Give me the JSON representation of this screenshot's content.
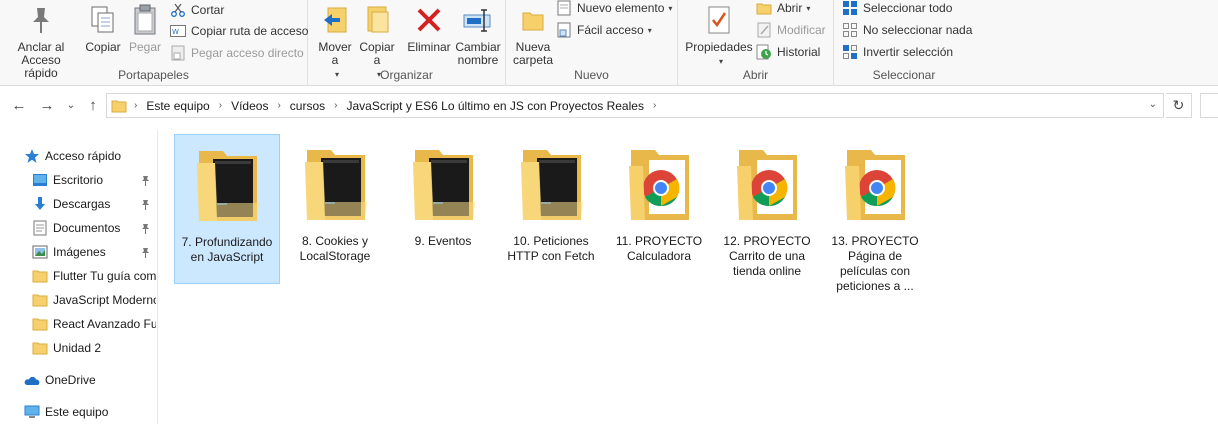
{
  "ribbon": {
    "portapapeles": {
      "label": "Portapapeles",
      "anclar": "Anclar al Acceso rápido",
      "copiar": "Copiar",
      "pegar": "Pegar",
      "cortar": "Cortar",
      "copiar_ruta": "Copiar ruta de acceso",
      "pegar_acceso": "Pegar acceso directo"
    },
    "organizar": {
      "label": "Organizar",
      "mover": "Mover a",
      "copiar_a": "Copiar a",
      "eliminar": "Eliminar",
      "cambiar": "Cambiar nombre"
    },
    "nuevo": {
      "label": "Nuevo",
      "nueva_carpeta": "Nueva carpeta",
      "nuevo_elemento": "Nuevo elemento",
      "facil_acceso": "Fácil acceso"
    },
    "abrir": {
      "label": "Abrir",
      "propiedades": "Propiedades",
      "abrir": "Abrir",
      "modificar": "Modificar",
      "historial": "Historial"
    },
    "seleccionar": {
      "label": "Seleccionar",
      "todo": "Seleccionar todo",
      "nada": "No seleccionar nada",
      "invertir": "Invertir selección"
    }
  },
  "breadcrumb": [
    "Este equipo",
    "Vídeos",
    "cursos",
    "JavaScript y ES6 Lo último en JS con Proyectos Reales"
  ],
  "navpane": {
    "quick_access": "Acceso rápido",
    "pinned": [
      "Escritorio",
      "Descargas",
      "Documentos",
      "Imágenes"
    ],
    "folders": [
      "Flutter Tu guía com",
      "JavaScript Moderno",
      "React Avanzado Ful",
      "Unidad 2"
    ],
    "onedrive": "OneDrive",
    "this_pc": "Este equipo"
  },
  "items": [
    {
      "name": "7. Profundizando en JavaScript",
      "thumb": "video",
      "selected": true
    },
    {
      "name": "8. Cookies y LocalStorage",
      "thumb": "video",
      "selected": false
    },
    {
      "name": "9. Eventos",
      "thumb": "video",
      "selected": false
    },
    {
      "name": "10. Peticiones HTTP con Fetch",
      "thumb": "video",
      "selected": false
    },
    {
      "name": "11. PROYECTO Calculadora",
      "thumb": "chrome",
      "selected": false
    },
    {
      "name": "12. PROYECTO Carrito de una tienda online",
      "thumb": "chrome",
      "selected": false
    },
    {
      "name": "13. PROYECTO Página de películas con peticiones a ...",
      "thumb": "chrome",
      "selected": false
    }
  ],
  "colors": {
    "selection_bg": "#cce8ff",
    "selection_border": "#99d1ff",
    "folder_yellow": "#f6d06b",
    "folder_dark": "#e8b84a",
    "delete_red": "#d42020",
    "accent_blue": "#1f6fc5"
  }
}
